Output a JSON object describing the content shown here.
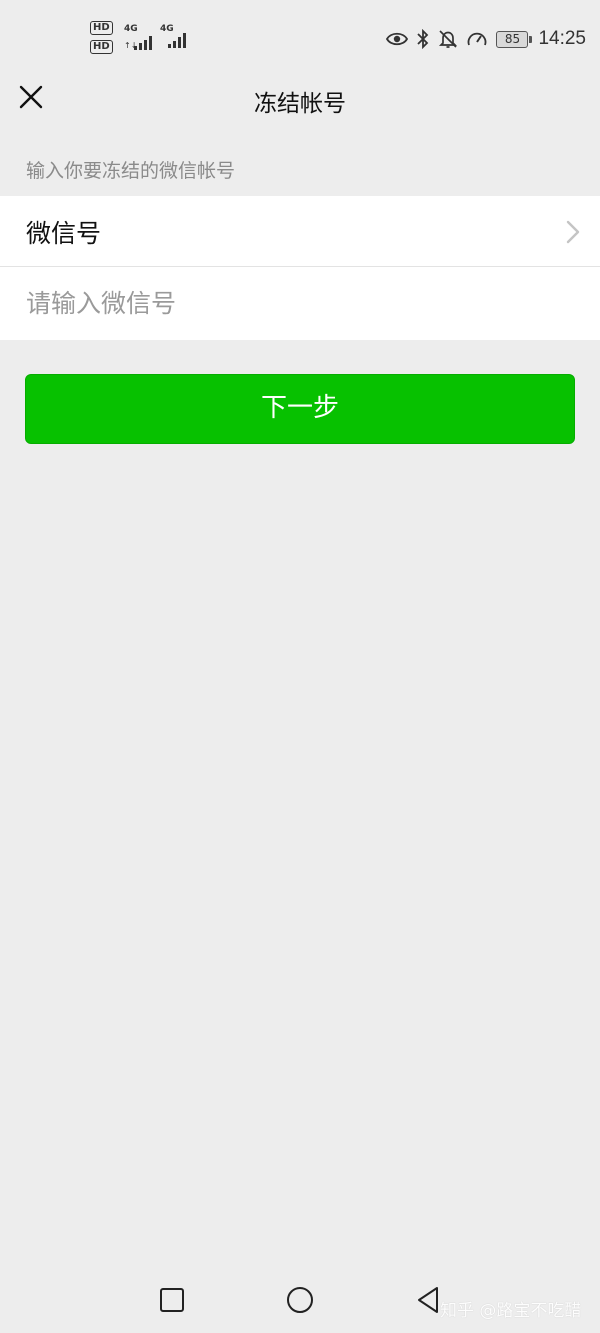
{
  "status_bar": {
    "network_badges": [
      "HD",
      "HD"
    ],
    "network_types": [
      "4G",
      "4G"
    ],
    "battery_level": "85",
    "time": "14:25",
    "icons": [
      "eye-icon",
      "bluetooth-icon",
      "bell-off-icon",
      "speedometer-icon",
      "battery-icon"
    ]
  },
  "nav": {
    "close_icon": "close-icon",
    "title": "冻结帐号"
  },
  "form": {
    "section_hint": "输入你要冻结的微信帐号",
    "account_type_label": "微信号",
    "account_input": {
      "value": "",
      "placeholder": "请输入微信号"
    }
  },
  "actions": {
    "next_label": "下一步"
  },
  "system_nav": {
    "icons": [
      "recent-apps-icon",
      "home-icon",
      "back-icon"
    ]
  },
  "watermark": {
    "text": "知乎 @路宝不吃醋"
  },
  "colors": {
    "primary_green": "#07c100",
    "background": "#ededed"
  }
}
